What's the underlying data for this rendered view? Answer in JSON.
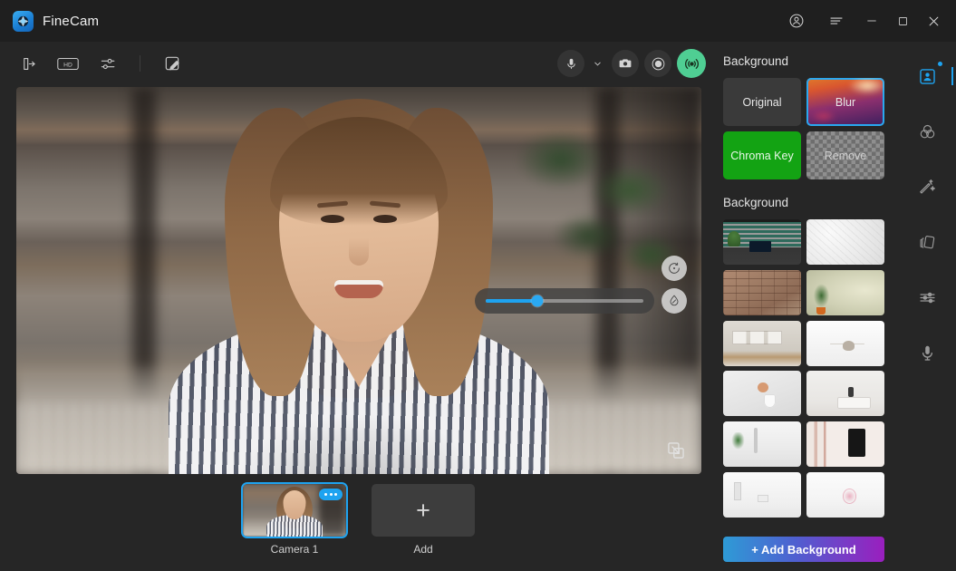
{
  "app": {
    "title": "FineCam",
    "logo_icon": "aperture-icon",
    "accent_blue": "#1ea3f0",
    "background": "#262626",
    "titlebar_bg": "#1f1f1f"
  },
  "titlebar": {
    "account_icon": "account-circle-icon",
    "menu_icon": "hamburger-menu-icon",
    "minimize_icon": "minimize-icon",
    "maximize_icon": "maximize-icon",
    "close_icon": "close-icon"
  },
  "toolbar": {
    "left_tools": [
      {
        "icon": "export-arrow-icon",
        "name": "virtual-camera-output"
      },
      {
        "icon": "hd-badge-icon",
        "name": "hd-quality"
      },
      {
        "icon": "sliders-icon",
        "name": "camera-settings"
      },
      {
        "icon": "whiteboard-pen-icon",
        "name": "annotation-board"
      }
    ],
    "right_tools": [
      {
        "icon": "microphone-icon",
        "name": "microphone"
      },
      {
        "icon": "chevron-down-icon",
        "name": "microphone-dropdown"
      },
      {
        "icon": "camera-icon",
        "name": "snapshot"
      },
      {
        "icon": "record-circle-icon",
        "name": "record"
      },
      {
        "icon": "broadcast-icon",
        "name": "live-stream",
        "color": "#4fce93"
      }
    ]
  },
  "preview": {
    "rotate_icon": "rotate-icon",
    "blur_icon": "water-drop-icon",
    "pip_icon": "picture-in-picture-icon",
    "blur_slider": {
      "value": 33,
      "min": 0,
      "max": 100,
      "fill_color": "#1ea3f0"
    }
  },
  "sources": {
    "items": [
      {
        "label": "Camera 1",
        "selected": true,
        "badge_icon": "more-dots-icon"
      }
    ],
    "add_label": "Add",
    "add_icon": "plus-icon"
  },
  "panel": {
    "mode_section_title": "Background",
    "modes": [
      {
        "label": "Original",
        "style": "original",
        "selected": false
      },
      {
        "label": "Blur",
        "style": "blur",
        "selected": true
      },
      {
        "label": "Chroma Key",
        "style": "chroma",
        "selected": false
      },
      {
        "label": "Remove",
        "style": "remove",
        "selected": false
      }
    ],
    "gallery_section_title": "Background",
    "thumbnails": [
      {
        "name": "office-desk-blinds",
        "art": "t-office"
      },
      {
        "name": "white-textured-wall",
        "art": "t-whitewall"
      },
      {
        "name": "brick-wall",
        "art": "t-brick"
      },
      {
        "name": "plant-beside-wall",
        "art": "t-plantwall"
      },
      {
        "name": "framed-art-wall",
        "art": "t-artwall"
      },
      {
        "name": "white-ceiling-lamp",
        "art": "t-lamp"
      },
      {
        "name": "vase-on-white-wall",
        "art": "t-vase"
      },
      {
        "name": "console-table-decor",
        "art": "t-console"
      },
      {
        "name": "bathroom-plant-shelf",
        "art": "t-bath"
      },
      {
        "name": "black-frame-poster",
        "art": "t-frame"
      },
      {
        "name": "white-shelf-decor",
        "art": "t-shelf2"
      },
      {
        "name": "pink-accent-wall",
        "art": "t-pinkwall"
      }
    ],
    "add_background_label": "+ Add Background",
    "add_background_gradient": [
      "#2e9bd6",
      "#9a1fbe"
    ]
  },
  "rail": {
    "items": [
      {
        "name": "background",
        "icon": "person-frame-icon",
        "active": true,
        "badge": true
      },
      {
        "name": "filters",
        "icon": "color-circles-icon",
        "active": false,
        "badge": false
      },
      {
        "name": "beauty",
        "icon": "magic-wand-icon",
        "active": false,
        "badge": false
      },
      {
        "name": "overlays",
        "icon": "layers-cards-icon",
        "active": false,
        "badge": false
      },
      {
        "name": "adjustments",
        "icon": "equalizer-icon",
        "active": false,
        "badge": false
      },
      {
        "name": "audio",
        "icon": "microphone-icon",
        "active": false,
        "badge": false
      }
    ]
  }
}
